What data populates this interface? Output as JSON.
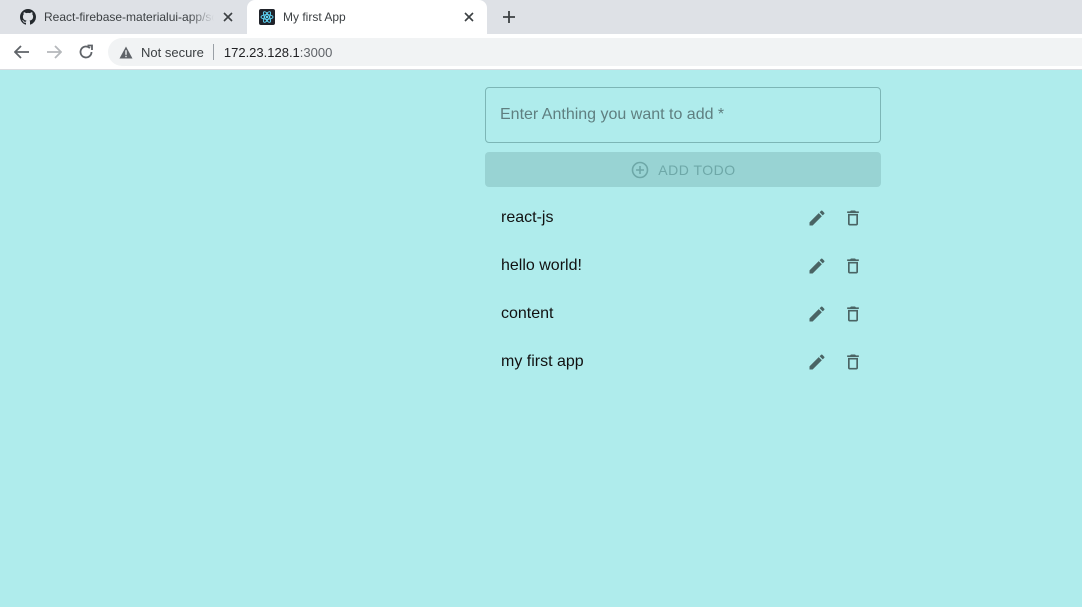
{
  "browser": {
    "tabs": [
      {
        "title": "React-firebase-materialui-app/sc",
        "active": false,
        "favicon": "github-icon"
      },
      {
        "title": "My first App",
        "active": true,
        "favicon": "react-icon"
      }
    ],
    "address": {
      "security_text": "Not secure",
      "host": "172.23.128.1",
      "port": ":3000"
    }
  },
  "app": {
    "input_placeholder": "Enter Anthing you want to add *",
    "add_button_label": "ADD TODO",
    "todos": [
      {
        "text": "react-js"
      },
      {
        "text": "hello world!"
      },
      {
        "text": "content"
      },
      {
        "text": "my first app"
      }
    ]
  },
  "colors": {
    "page_background": "#afecec",
    "button_background": "#98d3d3",
    "icon_color": "#4a6464"
  }
}
